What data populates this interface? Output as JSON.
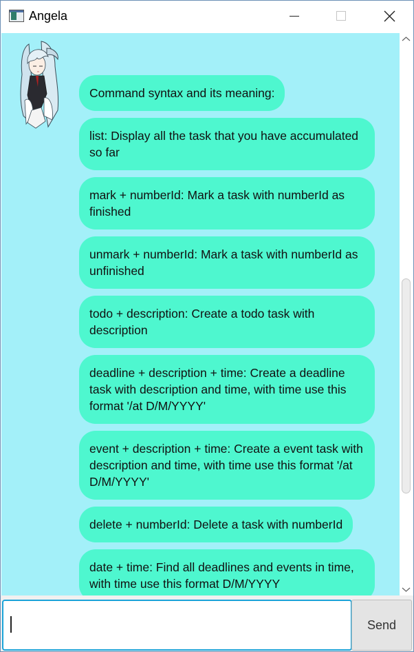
{
  "window": {
    "title": "Angela"
  },
  "chat": {
    "messages": [
      "Command syntax and its meaning:",
      "list: Display all the task that you have accumulated so far",
      "mark + numberId: Mark a task with numberId as finished",
      "unmark + numberId: Mark a task with numberId as unfinished",
      "todo + description: Create a todo task with description",
      "deadline + description + time: Create a deadline task with description and time, with time use this format '/at D/M/YYYY'",
      "event + description + time: Create a event task with description and time, with time use this format '/at D/M/YYYY'",
      "delete + numberId: Delete a task with numberId",
      "date + time: Find all deadlines and events in time, with time use this format D/M/YYYY"
    ],
    "avatar_icon": "anime-girl-avatar",
    "bubble_color": "#4ef7cf",
    "background_color": "#a3f0f9"
  },
  "input": {
    "value": "",
    "placeholder": ""
  },
  "send": {
    "label": "Send"
  }
}
